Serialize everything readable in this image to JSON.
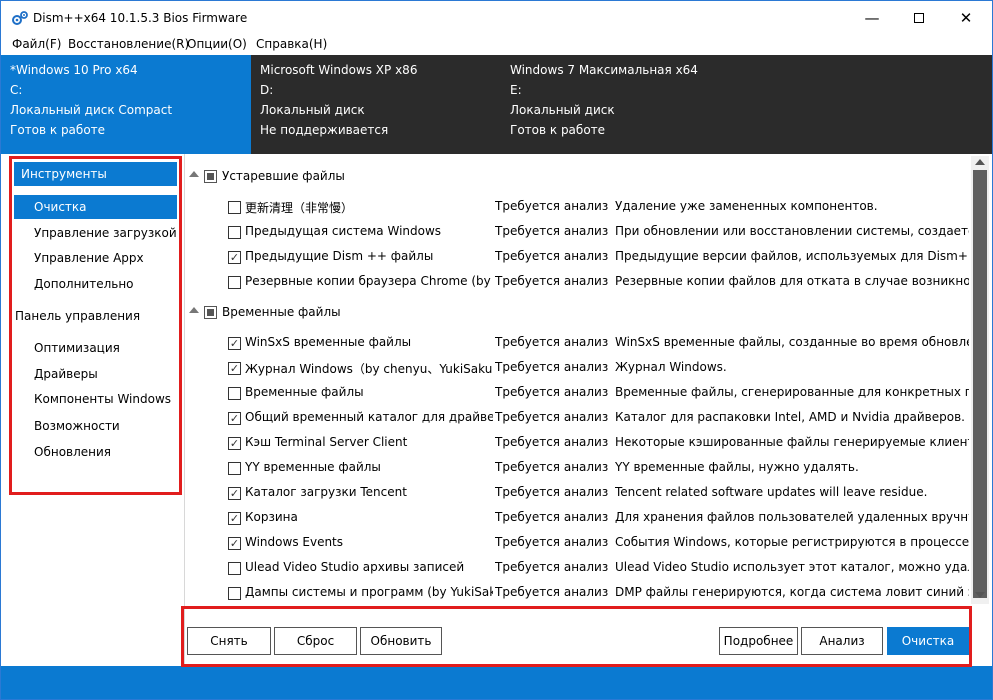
{
  "window": {
    "title": "Dism++x64 10.1.5.3 Bios Firmware"
  },
  "menu": [
    "Файл(F)",
    "Восстановление(R)",
    "Опции(O)",
    "Справка(H)"
  ],
  "sessions": [
    {
      "name": "*Windows 10 Pro x64",
      "drive": "C:",
      "disk": "Локальный диск Compact",
      "state": "Готов к работе"
    },
    {
      "name": "Microsoft Windows XP x86",
      "drive": "D:",
      "disk": "Локальный диск",
      "state": "Не поддерживается"
    },
    {
      "name": "Windows 7 Максимальная x64",
      "drive": "E:",
      "disk": "Локальный диск",
      "state": "Готов к работе"
    }
  ],
  "sidebar": {
    "tools_header": "Инструменты",
    "tools": [
      "Очистка",
      "Управление загрузкой",
      "Управление Appx",
      "Дополнительно"
    ],
    "control_header": "Панель управления",
    "control": [
      "Оптимизация",
      "Драйверы",
      "Компоненты Windows",
      "Возможности",
      "Обновления"
    ]
  },
  "groups": [
    {
      "label": "Устаревшие файлы",
      "items": [
        {
          "name": "更新清理（非常慢）",
          "status": "Требуется анализ",
          "desc": "Удаление уже замененных компонентов.",
          "checked": false
        },
        {
          "name": "Предыдущая система Windows",
          "status": "Требуется анализ",
          "desc": "При обновлении или восстановлении системы, создается ре",
          "checked": false
        },
        {
          "name": "Предыдущие Dism ++ файлы",
          "status": "Требуется анализ",
          "desc": "Предыдущие версии файлов, используемых для Dism++.",
          "checked": true
        },
        {
          "name": "Резервные копии браузера Chrome (by Ho",
          "status": "Требуется анализ",
          "desc": "Резервные копии файлов для отката в случае возникновени",
          "checked": false
        }
      ]
    },
    {
      "label": "Временные файлы",
      "items": [
        {
          "name": "WinSxS временные файлы",
          "status": "Требуется анализ",
          "desc": "WinSxS временные файлы, созданные во время обновления",
          "checked": true
        },
        {
          "name": "Журнал Windows（by chenyu、YukiSakura）",
          "status": "Требуется анализ",
          "desc": "Журнал Windows.",
          "checked": true
        },
        {
          "name": "Временные файлы",
          "status": "Требуется анализ",
          "desc": "Временные файлы, сгенерированные для конкретных польз",
          "checked": false
        },
        {
          "name": "Общий временный каталог для драйверов",
          "status": "Требуется анализ",
          "desc": "Каталог для распаковки Intel, AMD и Nvidia драйверов.",
          "checked": true
        },
        {
          "name": "Кэш Terminal Server Client",
          "status": "Требуется анализ",
          "desc": "Некоторые кэшированные файлы генерируемые клиентом с",
          "checked": true
        },
        {
          "name": "YY временные файлы",
          "status": "Требуется анализ",
          "desc": "YY временные файлы, нужно удалять.",
          "checked": false
        },
        {
          "name": "Каталог загрузки Tencent",
          "status": "Требуется анализ",
          "desc": "Tencent related software updates will leave residue.",
          "checked": true
        },
        {
          "name": "Корзина",
          "status": "Требуется анализ",
          "desc": "Для хранения файлов пользователей удаленных вручную.",
          "checked": true
        },
        {
          "name": "Windows Events",
          "status": "Требуется анализ",
          "desc": "События Windows, которые регистрируются в процессе рабо",
          "checked": true
        },
        {
          "name": "Ulead Video Studio архивы записей",
          "status": "Требуется анализ",
          "desc": "Ulead Video Studio использует этот каталог, можно удалять",
          "checked": false
        },
        {
          "name": "Дампы системы и программ (by YukiSakura",
          "status": "Требуется анализ",
          "desc": "DMP файлы генерируются, когда система ловит синий экра",
          "checked": false
        }
      ]
    }
  ],
  "buttons": {
    "remove": "Снять",
    "reset": "Сброс",
    "refresh": "Обновить",
    "details": "Подробнее",
    "analyze": "Анализ",
    "clean": "Очистка"
  },
  "colors": {
    "accent": "#0b7ad1",
    "highlight": "#e11d1d",
    "session_bg": "#2b2b2b"
  }
}
